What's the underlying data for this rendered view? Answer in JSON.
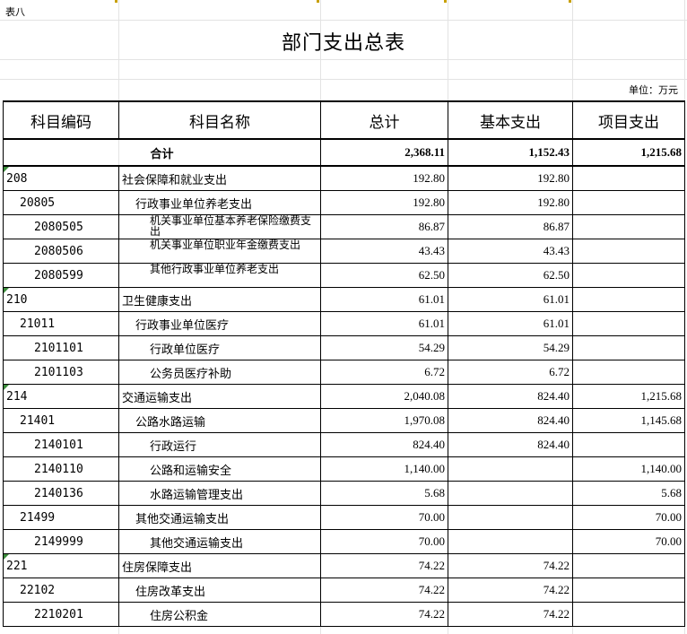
{
  "sheet_label": "表八",
  "title": "部门支出总表",
  "unit": "单位：万元",
  "headers": [
    "科目编码",
    "科目名称",
    "总计",
    "基本支出",
    "项目支出"
  ],
  "total": {
    "label": "合计",
    "total": "2,368.11",
    "basic": "1,152.43",
    "project": "1,215.68"
  },
  "rows": [
    {
      "code": "208",
      "name": "社会保障和就业支出",
      "total": "192.80",
      "basic": "192.80",
      "project": "",
      "level": 0
    },
    {
      "code": "20805",
      "name": "行政事业单位养老支出",
      "total": "192.80",
      "basic": "192.80",
      "project": "",
      "level": 1
    },
    {
      "code": "2080505",
      "name": "机关事业单位基本养老保险缴费支出",
      "total": "86.87",
      "basic": "86.87",
      "project": "",
      "level": 2
    },
    {
      "code": "2080506",
      "name": "机关事业单位职业年金缴费支出",
      "total": "43.43",
      "basic": "43.43",
      "project": "",
      "level": 2
    },
    {
      "code": "2080599",
      "name": "其他行政事业单位养老支出",
      "total": "62.50",
      "basic": "62.50",
      "project": "",
      "level": 2
    },
    {
      "code": "210",
      "name": "卫生健康支出",
      "total": "61.01",
      "basic": "61.01",
      "project": "",
      "level": 0
    },
    {
      "code": "21011",
      "name": "行政事业单位医疗",
      "total": "61.01",
      "basic": "61.01",
      "project": "",
      "level": 1
    },
    {
      "code": "2101101",
      "name": "行政单位医疗",
      "total": "54.29",
      "basic": "54.29",
      "project": "",
      "level": 2
    },
    {
      "code": "2101103",
      "name": "公务员医疗补助",
      "total": "6.72",
      "basic": "6.72",
      "project": "",
      "level": 2
    },
    {
      "code": "214",
      "name": "交通运输支出",
      "total": "2,040.08",
      "basic": "824.40",
      "project": "1,215.68",
      "level": 0
    },
    {
      "code": "21401",
      "name": "公路水路运输",
      "total": "1,970.08",
      "basic": "824.40",
      "project": "1,145.68",
      "level": 1
    },
    {
      "code": "2140101",
      "name": "行政运行",
      "total": "824.40",
      "basic": "824.40",
      "project": "",
      "level": 2
    },
    {
      "code": "2140110",
      "name": "公路和运输安全",
      "total": "1,140.00",
      "basic": "",
      "project": "1,140.00",
      "level": 2
    },
    {
      "code": "2140136",
      "name": "水路运输管理支出",
      "total": "5.68",
      "basic": "",
      "project": "5.68",
      "level": 2
    },
    {
      "code": "21499",
      "name": "其他交通运输支出",
      "total": "70.00",
      "basic": "",
      "project": "70.00",
      "level": 1
    },
    {
      "code": "2149999",
      "name": "其他交通运输支出",
      "total": "70.00",
      "basic": "",
      "project": "70.00",
      "level": 2
    },
    {
      "code": "221",
      "name": "住房保障支出",
      "total": "74.22",
      "basic": "74.22",
      "project": "",
      "level": 0
    },
    {
      "code": "22102",
      "name": "住房改革支出",
      "total": "74.22",
      "basic": "74.22",
      "project": "",
      "level": 1
    },
    {
      "code": "2210201",
      "name": "住房公积金",
      "total": "74.22",
      "basic": "74.22",
      "project": "",
      "level": 2
    }
  ]
}
